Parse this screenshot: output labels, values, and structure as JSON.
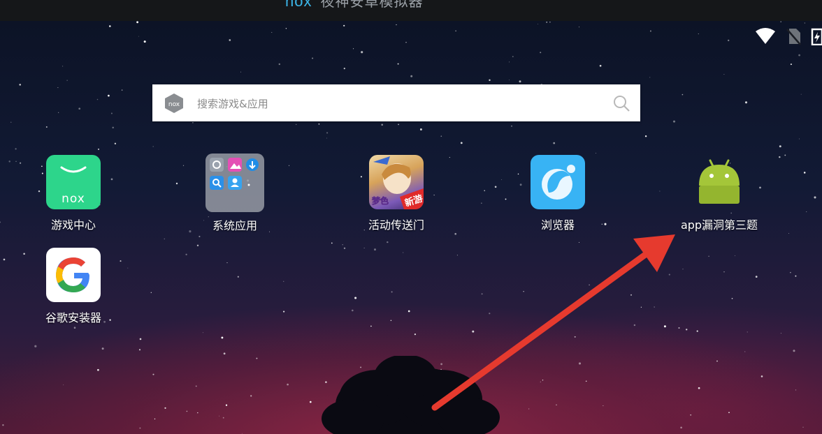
{
  "titlebar": {
    "brand": "nox",
    "subtitle": "夜神安卓模拟器"
  },
  "search": {
    "placeholder": "搜索游戏&应用",
    "logo_text": "nox"
  },
  "apps": [
    {
      "label": "游戏中心",
      "icon": "nox-game-center-icon"
    },
    {
      "label": "系统应用",
      "icon": "system-apps-folder-icon"
    },
    {
      "label": "活动传送门",
      "icon": "event-portal-icon",
      "badge": "新游",
      "badge_left": "梦色"
    },
    {
      "label": "浏览器",
      "icon": "browser-icon"
    },
    {
      "label": "app漏洞第三题",
      "icon": "android-icon"
    },
    {
      "label": "谷歌安装器",
      "icon": "google-icon"
    }
  ],
  "colors": {
    "accent_nox": "#3bb6e8",
    "game_center_green": "#2dd58b",
    "browser_blue": "#38b3f4",
    "android_green": "#a4c639",
    "arrow_red": "#e63a2e"
  }
}
